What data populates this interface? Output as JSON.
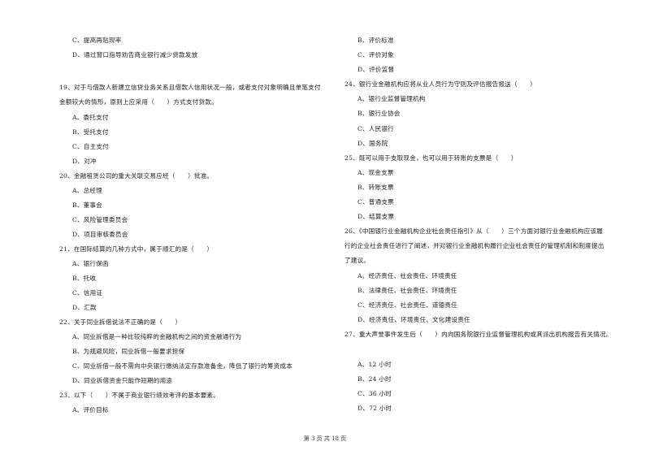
{
  "left_column": {
    "q18_tail": {
      "options": [
        {
          "label": "C、提高再贴现率"
        },
        {
          "label": "D、通过窗口指导劝告商业银行减少贷款发放"
        }
      ]
    },
    "q19": {
      "stem_lines": [
        "19、对于与借款人新建立信贷业务关系且借款人信用状况一般，或者支付对象明确且单笔支付",
        "金额较大的情形，原则上应采用（　　）方式支付贷款。"
      ],
      "options": [
        {
          "label": "A、委托支付"
        },
        {
          "label": "B、受托支付"
        },
        {
          "label": "C、自主支付"
        },
        {
          "label": "D、对冲"
        }
      ]
    },
    "q20": {
      "stem": "20、金融租赁公司的重大关联交易应经（　　）批准。",
      "options": [
        {
          "label": "A、总经理"
        },
        {
          "label": "B、董事会"
        },
        {
          "label": "C、风险管理委员会"
        },
        {
          "label": "D、项目审核委员会"
        }
      ]
    },
    "q21": {
      "stem": "21、在国际结算的几种方式中，属于顺汇的是（　　）",
      "options": [
        {
          "label": "A、银行保函"
        },
        {
          "label": "B、托收"
        },
        {
          "label": "C、信用证"
        },
        {
          "label": "D、汇款"
        }
      ]
    },
    "q22": {
      "stem": "22、关于同业拆借说法不正确的是（　　）",
      "options": [
        {
          "label": "A、同业拆借是一种比较纯粹的金融机构之间的资金融通行为"
        },
        {
          "label": "B、为规避风险，同业拆借一般要求担保"
        },
        {
          "label": "C、同业拆借一般不需向中央银行缴纳法定存款准备金，降低了银行的筹资成本"
        },
        {
          "label": "D、同业拆借资金只能作短期的用途"
        }
      ]
    },
    "q23": {
      "stem": "23、以下（　　）不属于商业银行绩效考评的基本要素。",
      "options": [
        {
          "label": "A、评价目标"
        }
      ]
    }
  },
  "right_column": {
    "q23_tail": {
      "options": [
        {
          "label": "B、评价标准"
        },
        {
          "label": "C、评价对象"
        },
        {
          "label": "D、评价监督"
        }
      ]
    },
    "q24": {
      "stem": "24、银行业金融机构应将从业人员行为守则及评估报告报送（　　）",
      "options": [
        {
          "label": "A、银行业监督管理机构"
        },
        {
          "label": "B、银行业协会"
        },
        {
          "label": "C、人民银行"
        },
        {
          "label": "D、国务院"
        }
      ]
    },
    "q25": {
      "stem": "25、既可以用于支取现金，也可以用于转账的支票是（　　）",
      "options": [
        {
          "label": "A、现金支票"
        },
        {
          "label": "B、转账支票"
        },
        {
          "label": "C、普通支票"
        },
        {
          "label": "D、结算支票"
        }
      ]
    },
    "q26": {
      "stem_lines": [
        "26、《中国银行业金融机构企业社会责任指引》从（　　）三个方面对银行业金融机构应该履",
        "行的企业社会责任进行了阐述，并对银行业金融机构履行企业社会责任的管理机制和制度提出",
        "了建议。"
      ],
      "options": [
        {
          "label": "A、经济责任、社会责任、环境责任"
        },
        {
          "label": "B、法律责任、社会责任、环境责任"
        },
        {
          "label": "C、经济责任、社会责任、道德责任"
        },
        {
          "label": "D、经济责任、环境责任、文化建设责任"
        }
      ]
    },
    "q27": {
      "stem": "27、重大声誉事件发生后（　　）内向国务院银行业监督管理机构或其派出机构报告有关情况。",
      "options": [
        {
          "label": "A、12 小时"
        },
        {
          "label": "B、24 小时"
        },
        {
          "label": "C、36 小时"
        },
        {
          "label": "D、72 小时"
        }
      ]
    }
  },
  "footer": {
    "page_indicator": "第 3 页 共 18 页"
  }
}
